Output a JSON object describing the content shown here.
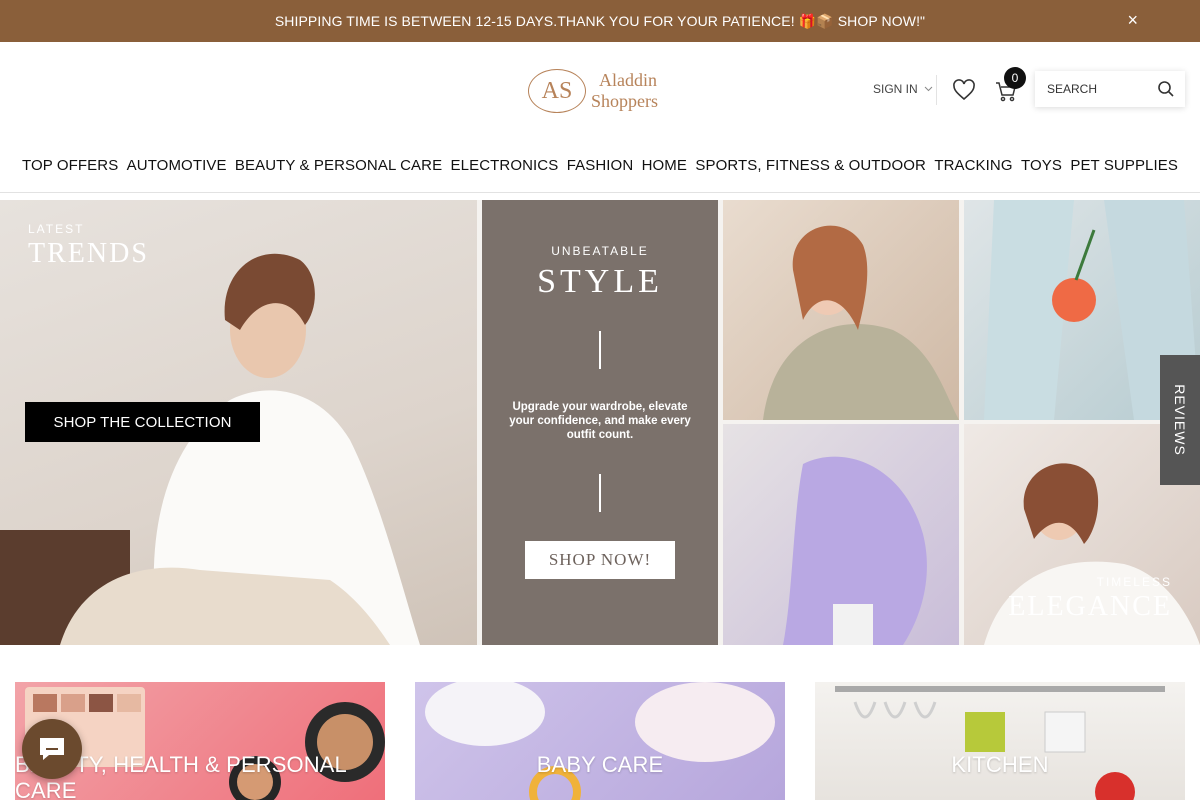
{
  "announcement": {
    "text": "SHIPPING TIME IS BETWEEN 12-15 DAYS.THANK YOU FOR YOUR PATIENCE! 🎁📦 SHOP NOW!\"",
    "close": "×"
  },
  "header": {
    "logo_mark": "AS",
    "logo_line1": "Aladdin",
    "logo_line2": "Shoppers",
    "signin": "SIGN IN",
    "cart_count": "0",
    "search_placeholder": "SEARCH"
  },
  "nav": {
    "items": [
      "TOP OFFERS",
      "AUTOMOTIVE",
      "BEAUTY & PERSONAL CARE",
      "ELECTRONICS",
      "FASHION",
      "HOME",
      "SPORTS, FITNESS & OUTDOOR",
      "TRACKING",
      "TOYS",
      "PET SUPPLIES"
    ]
  },
  "hero": {
    "latest": "LATEST",
    "trends": "TRENDS",
    "shop_collection": "SHOP THE COLLECTION",
    "unbeatable": "UNBEATABLE",
    "style": "STYLE",
    "upgrade_text": "Upgrade your wardrobe, elevate your confidence, and make every outfit count.",
    "shop_now": "SHOP NOW!",
    "timeless": "TIMELESS",
    "elegance": "ELEGANCE"
  },
  "reviews_tab": "REVIEWS",
  "categories": [
    "BEAUTY, HEALTH & PERSONAL CARE",
    "BABY CARE",
    "KITCHEN"
  ]
}
